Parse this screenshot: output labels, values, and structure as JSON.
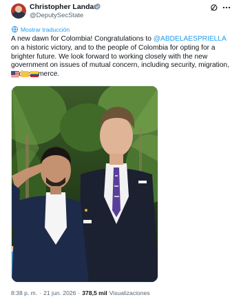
{
  "author": {
    "name": "Christopher Landau",
    "handle": "@DeputySecState",
    "verified_color": "#829aab"
  },
  "header_icons": [
    "grok-icon",
    "more-icon"
  ],
  "translate_link": {
    "label": "Mostrar traducción",
    "color": "#1d9bf0"
  },
  "post": {
    "text_before_mention": "A new dawn for Colombia! Congratulations to ",
    "mention": "@ABDELAESPRIELLA",
    "text_after_mention": " on a historic victory, and to the people of Colombia for opting for a brighter future. We look forward to working closely with the new government on issues of mutual concern, including security, migration, and commerce.",
    "emojis": [
      "us-flag-icon",
      "handshake-icon",
      "colombia-flag-icon"
    ]
  },
  "media": {
    "description_icon": "photo-of-two-men"
  },
  "meta": {
    "time": "8:38 p. m.",
    "separator": "·",
    "date": "21 jun. 2026",
    "views_count": "378,5 mil",
    "views_label": "Visualizaciones"
  }
}
